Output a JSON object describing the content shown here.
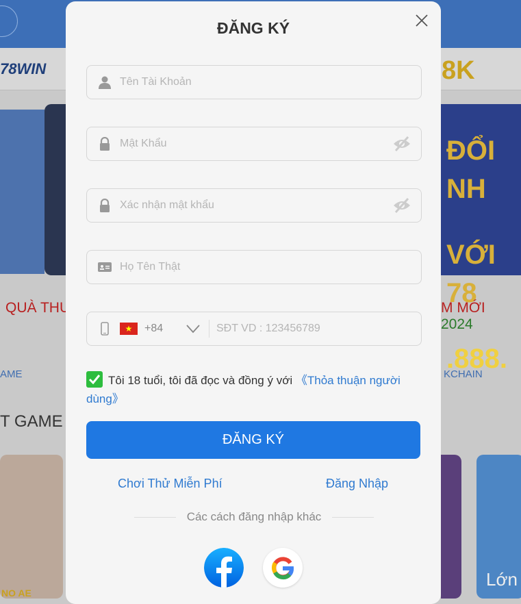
{
  "background": {
    "logo": "78WIN",
    "promo_tag": "8K",
    "banner_right": [
      "ĐỔI NH",
      "VỚI 78",
      ".888."
    ],
    "marquee_left": "QUÀ THƯ",
    "marquee_right": "M MỚI",
    "marquee_year": "2024",
    "tab_left": "AME",
    "tab_right": "KCHAIN",
    "section_title": "T GAME",
    "card_left_label": "NO AE",
    "card_right_label": "Lớn"
  },
  "modal": {
    "title": "ĐĂNG KÝ",
    "username_placeholder": "Tên Tài Khoản",
    "password_placeholder": "Mật Khẩu",
    "confirm_placeholder": "Xác nhận mật khẩu",
    "fullname_placeholder": "Họ Tên Thật",
    "country_code": "+84",
    "phone_placeholder": "SĐT VD : 123456789",
    "agree_text": "Tôi 18 tuổi, tôi đã đọc và đồng ý với ",
    "agree_link": "《Thỏa thuận người dùng》",
    "agree_checked": true,
    "submit_label": "ĐĂNG KÝ",
    "free_play_link": "Chơi Thử Miễn Phí",
    "login_link": "Đăng Nhập",
    "other_methods": "Các cách đăng nhập khác",
    "social": [
      "facebook-icon",
      "google-icon"
    ]
  },
  "colors": {
    "accent": "#1f78e2",
    "link": "#2f7ad0",
    "checkbox": "#2dbd3e"
  }
}
